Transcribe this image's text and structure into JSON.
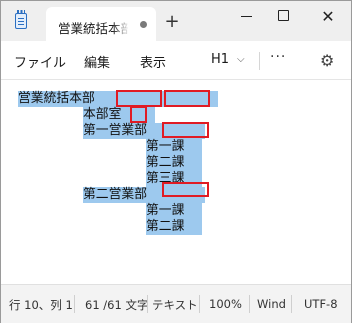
{
  "tab": {
    "title": "営業統括本部",
    "new_tab": "+"
  },
  "window": {
    "minimize": "",
    "maximize": "",
    "close": "✕"
  },
  "menu": {
    "file": "ファイル",
    "edit": "編集",
    "view": "表示",
    "heading": "H1",
    "heading_chevron": "⌵",
    "more": "···",
    "settings": "⚙"
  },
  "editor": {
    "lines": [
      "営業統括本部",
      "本部室",
      "第一営業部",
      "第一課",
      "第二課",
      "第三課",
      "第二営業部",
      "第一課",
      "第二課"
    ]
  },
  "status": {
    "position": "行 10、列 1",
    "chars": "61 /61 文字",
    "format": "テキスト",
    "zoom": "100%",
    "line_ending": "Wind",
    "encoding": "UTF-8"
  }
}
